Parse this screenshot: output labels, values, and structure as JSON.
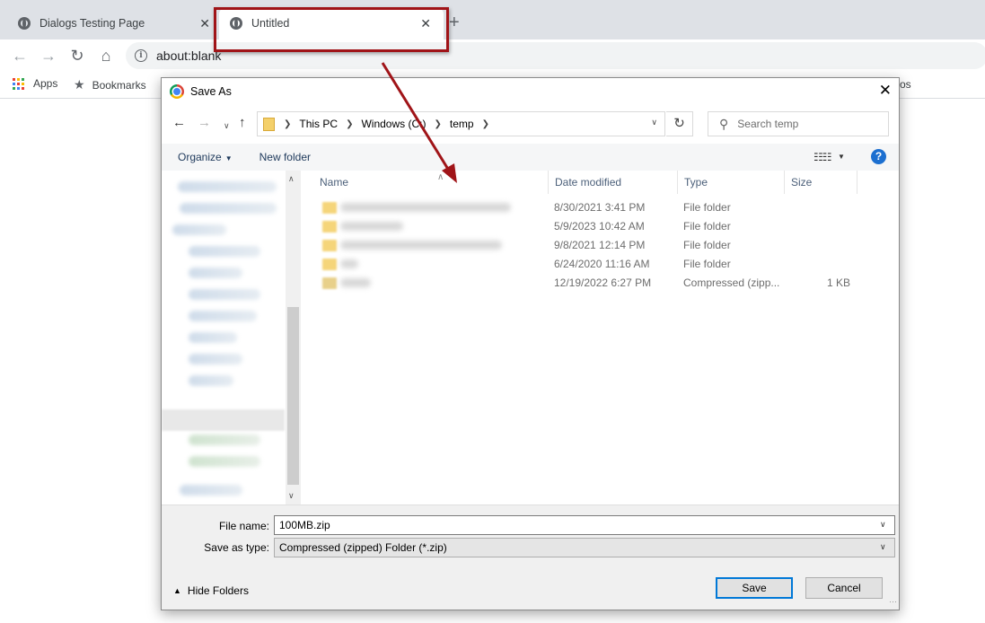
{
  "browser": {
    "tabs": [
      {
        "title": "Dialogs Testing Page",
        "close": "✕"
      },
      {
        "title": "Untitled",
        "close": "✕"
      }
    ],
    "new_tab": "+",
    "url": "about:blank",
    "bookmarks": [
      {
        "label": "Apps"
      },
      {
        "label": "Bookmarks"
      }
    ],
    "other_bookmarks_partial": "ros",
    "apps_colors": [
      "#ea4335",
      "#fbbc04",
      "#34a853",
      "#4285f4",
      "#ea4335",
      "#fbbc04",
      "#34a853",
      "#4285f4",
      "#ea4335"
    ]
  },
  "annotation": {
    "color": "#a01418"
  },
  "dialog": {
    "title": "Save As",
    "close": "✕",
    "breadcrumb": [
      "This PC",
      "Windows (C:)",
      "temp"
    ],
    "search_placeholder": "Search temp",
    "commands": {
      "organize": "Organize",
      "new_folder": "New folder",
      "help": "?"
    },
    "columns": [
      "Name",
      "Date modified",
      "Type",
      "Size"
    ],
    "files": [
      {
        "date": "8/30/2021 3:41 PM",
        "type": "File folder",
        "size": ""
      },
      {
        "date": "5/9/2023 10:42 AM",
        "type": "File folder",
        "size": ""
      },
      {
        "date": "9/8/2021 12:14 PM",
        "type": "File folder",
        "size": ""
      },
      {
        "date": "6/24/2020 11:16 AM",
        "type": "File folder",
        "size": ""
      },
      {
        "date": "12/19/2022 6:27 PM",
        "type": "Compressed (zipp...",
        "size": "1 KB"
      }
    ],
    "file_name_label": "File name:",
    "file_name_value": "100MB.zip",
    "save_type_label": "Save as type:",
    "save_type_value": "Compressed (zipped) Folder (*.zip)",
    "hide_folders": "Hide Folders",
    "save_button": "Save",
    "cancel_button": "Cancel"
  }
}
